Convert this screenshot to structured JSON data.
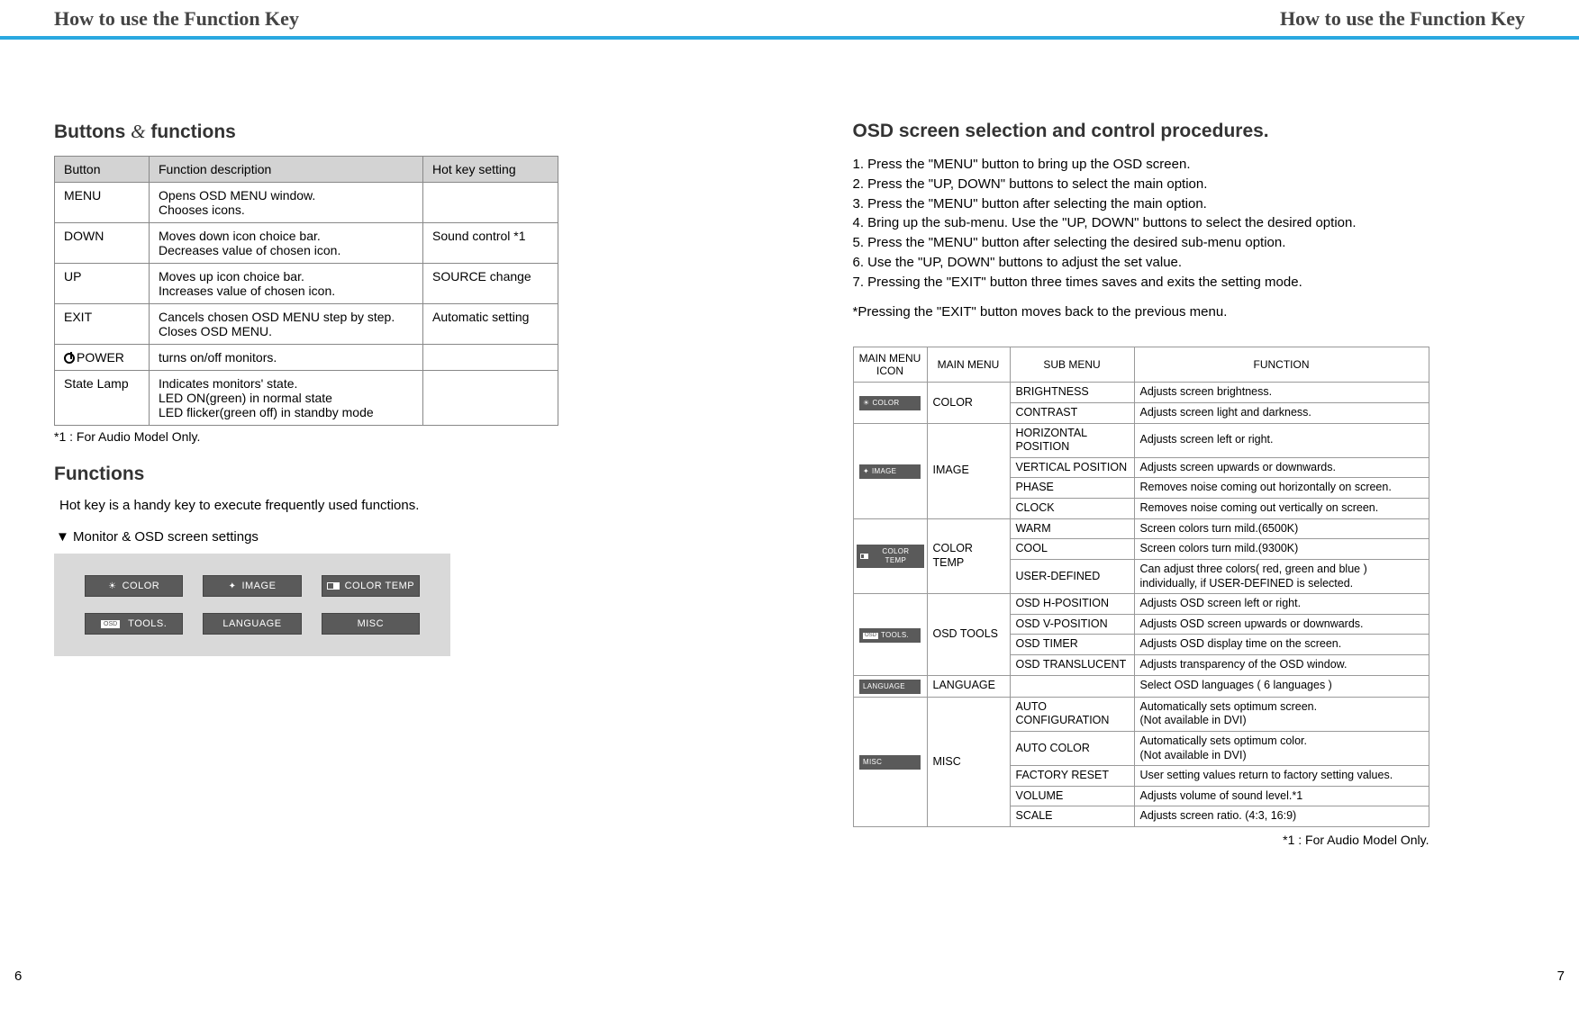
{
  "header": {
    "left_title": "How to use the Function Key",
    "right_title": "How to use the Function Key"
  },
  "left": {
    "section_title_a": "Buttons",
    "section_title_amp": "&",
    "section_title_b": "functions",
    "table_headers": {
      "button": "Button",
      "desc": "Function description",
      "hotkey": "Hot key setting"
    },
    "rows": [
      {
        "button": "MENU",
        "desc": "Opens OSD MENU window.\nChooses icons.",
        "hotkey": ""
      },
      {
        "button": "DOWN",
        "desc": "Moves down icon choice bar.\nDecreases value of chosen icon.",
        "hotkey": "Sound control *1"
      },
      {
        "button": "UP",
        "desc": "Moves up icon choice bar.\nIncreases value of chosen icon.",
        "hotkey": "SOURCE change"
      },
      {
        "button": "EXIT",
        "desc": "Cancels chosen OSD MENU step by step.\nCloses OSD MENU.",
        "hotkey": "Automatic setting"
      },
      {
        "button": "POWER",
        "desc": "turns on/off monitors.",
        "hotkey": "",
        "icon": "power"
      },
      {
        "button": "State Lamp",
        "desc": "Indicates monitors' state.\nLED ON(green) in normal state\nLED flicker(green off) in standby mode",
        "hotkey": ""
      }
    ],
    "footnote": "*1 : For Audio Model Only.",
    "functions_heading": "Functions",
    "functions_intro": "Hot key is a handy key to execute frequently used functions.",
    "sub_caption": "▼ Monitor & OSD screen settings",
    "osd_items": [
      {
        "icon": "sun",
        "label": "COLOR"
      },
      {
        "icon": "diamond",
        "label": "IMAGE"
      },
      {
        "icon": "ct",
        "label": "COLOR TEMP"
      },
      {
        "icon": "osd",
        "label": "TOOLS."
      },
      {
        "icon": "",
        "label": "LANGUAGE"
      },
      {
        "icon": "",
        "label": "MISC"
      }
    ]
  },
  "right": {
    "heading": "OSD screen selection and control procedures.",
    "steps": [
      "1. Press the \"MENU\" button to bring up the OSD screen.",
      "2. Press the \"UP, DOWN\" buttons to select the main option.",
      "3. Press the \"MENU\" button after selecting the main option.",
      "4. Bring up the sub-menu. Use the \"UP, DOWN\" buttons to select the desired option.",
      "5. Press the \"MENU\" button after selecting the desired sub-menu option.",
      "6. Use the \"UP, DOWN\" buttons to adjust the set value.",
      "7. Pressing the \"EXIT\" button three times saves and exits the setting mode."
    ],
    "note": "*Pressing the \"EXIT\" button moves back to the previous menu.",
    "grid_headers": {
      "icon": "MAIN MENU ICON",
      "main": "MAIN MENU",
      "sub": "SUB MENU",
      "func": "FUNCTION"
    },
    "grid": [
      {
        "icon": "sun",
        "icon_label": "COLOR",
        "main": "COLOR",
        "subs": [
          {
            "sub": "BRIGHTNESS",
            "func": "Adjusts screen brightness."
          },
          {
            "sub": "CONTRAST",
            "func": "Adjusts screen light and darkness."
          }
        ]
      },
      {
        "icon": "diamond",
        "icon_label": "IMAGE",
        "main": "IMAGE",
        "subs": [
          {
            "sub": "HORIZONTAL POSITION",
            "func": "Adjusts screen left or right."
          },
          {
            "sub": "VERTICAL POSITION",
            "func": "Adjusts screen upwards or downwards."
          },
          {
            "sub": "PHASE",
            "func": "Removes noise coming out horizontally on screen."
          },
          {
            "sub": "CLOCK",
            "func": "Removes noise coming out vertically on screen."
          }
        ]
      },
      {
        "icon": "ct",
        "icon_label": "COLOR TEMP",
        "main": "COLOR TEMP",
        "subs": [
          {
            "sub": "WARM",
            "func": "Screen colors turn mild.(6500K)"
          },
          {
            "sub": "COOL",
            "func": "Screen colors turn mild.(9300K)"
          },
          {
            "sub": "USER-DEFINED",
            "func": "Can adjust three colors( red, green and blue ) individually, if USER-DEFINED is selected."
          }
        ]
      },
      {
        "icon": "osd",
        "icon_label": "TOOLS.",
        "main": "OSD TOOLS",
        "subs": [
          {
            "sub": "OSD H-POSITION",
            "func": "Adjusts OSD screen left or right."
          },
          {
            "sub": "OSD V-POSITION",
            "func": "Adjusts OSD screen upwards or downwards."
          },
          {
            "sub": "OSD TIMER",
            "func": "Adjusts OSD display time on the screen."
          },
          {
            "sub": "OSD TRANSLUCENT",
            "func": "Adjusts transparency of the OSD window."
          }
        ]
      },
      {
        "icon": "",
        "icon_label": "LANGUAGE",
        "main": "LANGUAGE",
        "subs": [
          {
            "sub": "",
            "func": "Select OSD languages ( 6 languages )"
          }
        ]
      },
      {
        "icon": "",
        "icon_label": "MISC",
        "main": "MISC",
        "subs": [
          {
            "sub": "AUTO CONFIGURATION",
            "func": "Automatically sets optimum screen.\n(Not available in DVI)"
          },
          {
            "sub": "AUTO COLOR",
            "func": "Automatically sets optimum color.\n(Not available in DVI)"
          },
          {
            "sub": "FACTORY RESET",
            "func": "User setting values return to factory setting values."
          },
          {
            "sub": "VOLUME",
            "func": "Adjusts volume of sound level.*1"
          },
          {
            "sub": "SCALE",
            "func": "Adjusts screen ratio. (4:3, 16:9)"
          }
        ]
      }
    ],
    "footnote": "*1 : For Audio Model Only."
  },
  "pages": {
    "left": "6",
    "right": "7"
  }
}
